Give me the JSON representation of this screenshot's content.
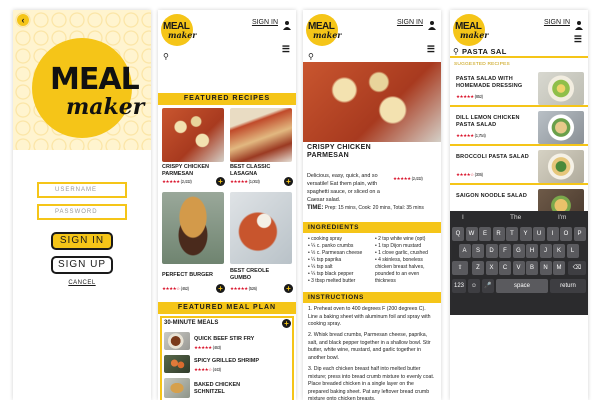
{
  "brand": {
    "meal": "MEAL",
    "maker": "maker"
  },
  "login": {
    "username_placeholder": "USERNAME",
    "password_placeholder": "PASSWORD",
    "sign_in": "SIGN IN",
    "sign_up": "SIGN UP",
    "cancel": "CANCEL"
  },
  "header": {
    "sign_in": "SIGN IN"
  },
  "home": {
    "featured_recipes": "FEATURED RECIPES",
    "recipes": [
      {
        "title": "CRISPY CHICKEN PARMESAN",
        "stars": "★★★★★",
        "count": "(2,432)"
      },
      {
        "title": "BEST CLASSIC LASAGNA",
        "stars": "★★★★★",
        "count": "(1,063)"
      },
      {
        "title": "PERFECT BURGER",
        "stars": "★★★★☆",
        "count": "(462)"
      },
      {
        "title": "BEST CREOLE GUMBO",
        "stars": "★★★★★",
        "count": "(526)"
      }
    ],
    "featured_meal_plan": "FEATURED MEAL PLAN",
    "plan_title": "30-MINUTE MEALS",
    "plan_items": [
      {
        "title": "QUICK BEEF STIR FRY",
        "stars": "★★★★★",
        "count": "(463)"
      },
      {
        "title": "SPICY GRILLED SHRIMP",
        "stars": "★★★★☆",
        "count": "(443)"
      },
      {
        "title": "BAKED CHICKEN SCHNITZEL",
        "stars": "",
        "count": ""
      }
    ]
  },
  "recipe": {
    "title": "CRISPY CHICKEN PARMESAN",
    "stars": "★★★★★",
    "count": "(2,432)",
    "description": "Delicious, easy, quick, and so versatile! Eat them plain, with spaghetti sauce, or sliced on a Caesar salad.",
    "time_label": "TIME:",
    "time_text": "Prep: 15 mins, Cook: 20 mins, Total: 35 mins",
    "ingredients_label": "INGREDIENTS",
    "ingredients_left": [
      "• cooking spray",
      "• ¼ c. panko crumbs",
      "• ½ c. Parmesan cheese",
      "• ¼ tsp paprika",
      "• ¼ tsp salt",
      "• ¼ tsp black pepper",
      "• 3 tbsp melted butter"
    ],
    "ingredients_right": [
      "• 2 tsp white wine (opt)",
      "• 1 tsp Dijon mustard",
      "• 1 clove garlic, crushed",
      "• 4 skinless, boneless",
      "  chicken breast halves,",
      "  pounded to an even",
      "  thickness"
    ],
    "instructions_label": "INSTRUCTIONS",
    "steps": [
      "1. Preheat oven to 400 degrees F (200 degrees C). Line a baking sheet with aluminum foil and spray with cooking spray.",
      "2. Whisk bread crumbs, Parmesan cheese, paprika, salt, and black pepper together in a shallow bowl. Stir butter, white wine, mustard, and garlic together in another bowl.",
      "3. Dip each chicken breast half into melted butter mixture; press into bread crumb mixture to evenly coat. Place breaded chicken in a single layer on the prepared baking sheet. Pat any leftover bread crumb mixture onto chicken breasts."
    ]
  },
  "search": {
    "query": "PASTA SAL",
    "suggested_label": "SUGGESTED RECIPES",
    "results": [
      {
        "title": "PASTA SALAD WITH HOMEMADE DRESSING",
        "stars": "★★★★★",
        "count": "(852)"
      },
      {
        "title": "DILL LEMON CHICKEN PASTA SALAD",
        "stars": "★★★★★",
        "count": "(1,754)"
      },
      {
        "title": "BROCCOLI PASTA SALAD",
        "stars": "★★★★☆",
        "count": "(306)"
      },
      {
        "title": "SAIGON NOODLE SALAD",
        "stars": "★★★★★",
        "count": ""
      }
    ],
    "keyboard": {
      "suggestions": [
        "I",
        "The",
        "I'm"
      ],
      "row1": [
        "Q",
        "W",
        "E",
        "R",
        "T",
        "Y",
        "U",
        "I",
        "O",
        "P"
      ],
      "row2": [
        "A",
        "S",
        "D",
        "F",
        "G",
        "H",
        "J",
        "K",
        "L"
      ],
      "row3": [
        "Z",
        "X",
        "C",
        "V",
        "B",
        "N",
        "M"
      ],
      "numbers": "123",
      "space": "space",
      "return": "return"
    }
  }
}
